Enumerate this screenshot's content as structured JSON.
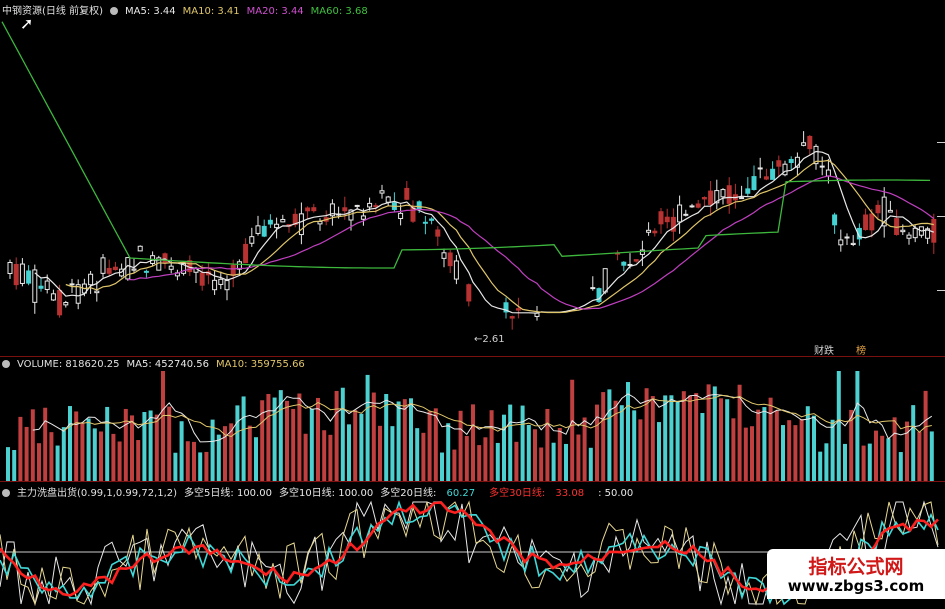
{
  "price_header": {
    "stock": "中钢资源(日线 前复权)",
    "ma5": "MA5: 3.44",
    "ma10": "MA10: 3.41",
    "ma20": "MA20: 3.44",
    "ma60": "MA60: 3.68"
  },
  "volume_header": {
    "volume": "VOLUME: 818620.25",
    "ma5": "MA5: 452740.56",
    "ma10": "MA10: 359755.66"
  },
  "osc_header": {
    "name": "主力洗盘出货(0.99,1,0.99,72,1,2)",
    "d5": "多空5日线: 100.00",
    "d10": "多空10日线: 100.00",
    "d20_label": "多空20日线:",
    "d20_value": "60.27",
    "d30_label": "多空30日线:",
    "d30_value": "33.08",
    "extra": ": 50.00"
  },
  "annotations": {
    "low_price": "←2.61",
    "tag_finance": "财",
    "tag_cut": "跌",
    "tag_list": "榜"
  },
  "watermark": {
    "title": "指标公式网",
    "url": "www.zbgs3.com"
  },
  "colors": {
    "up": "#e8e8e8",
    "up_fill": "#000000",
    "down": "#b83232",
    "down_alt": "#45d2d2",
    "ma5": "#e8e8e8",
    "ma10": "#e0c66a",
    "ma20": "#c040c0",
    "ma60": "#3db83d",
    "vol_up": "#c04040",
    "vol_down": "#4dd0d0",
    "osc_red": "#ff2020",
    "osc_cyan": "#40d8d8",
    "osc_white": "#e8e8e8",
    "osc_yellow": "#e8d890",
    "separator": "#7a1010"
  },
  "chart_data": {
    "type": "candlestick",
    "title": "中钢资源(日线 前复权)",
    "last_values": {
      "MA5": 3.44,
      "MA10": 3.41,
      "MA20": 3.44,
      "MA60": 3.68
    },
    "annotated_low": 2.61,
    "series": [
      {
        "name": "MA5",
        "color": "#e8e8e8"
      },
      {
        "name": "MA10",
        "color": "#e0c66a"
      },
      {
        "name": "MA20",
        "color": "#c040c0"
      },
      {
        "name": "MA60",
        "color": "#3db83d"
      }
    ],
    "volume": {
      "VOLUME": 818620.25,
      "MA5": 452740.56,
      "MA10": 359755.66
    },
    "oscillator": {
      "name": "主力洗盘出货",
      "params": [
        0.99,
        1,
        0.99,
        72,
        1,
        2
      ],
      "多空5日线": 100.0,
      "多空10日线": 100.0,
      "多空20日线": 60.27,
      "多空30日线": 33.08,
      "reference": 50.0
    }
  }
}
